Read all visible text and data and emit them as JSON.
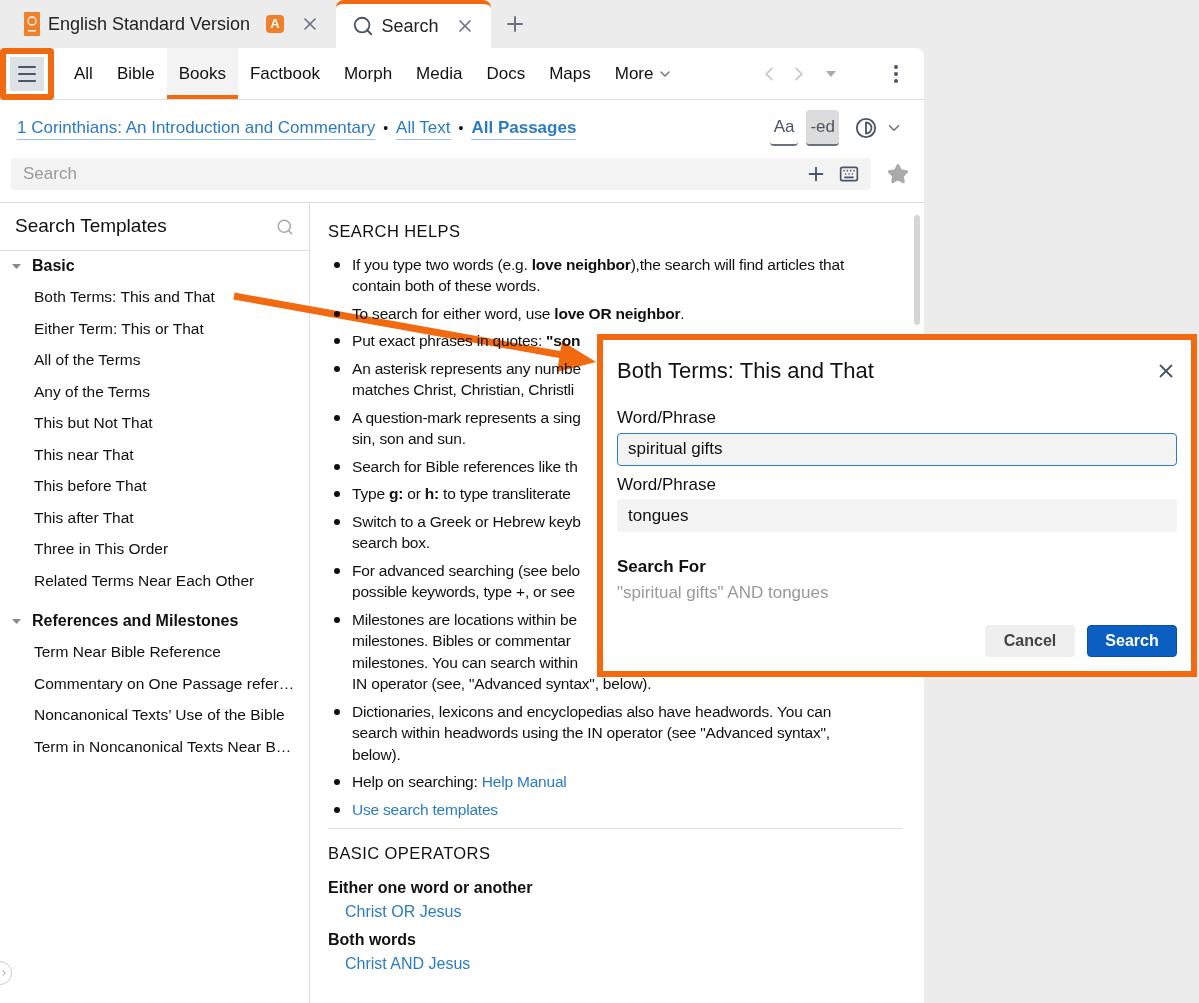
{
  "tabs": [
    {
      "label": "English Standard Version",
      "kind": "book",
      "badge": "A",
      "selected": false
    },
    {
      "label": "Search",
      "kind": "search",
      "selected": true
    }
  ],
  "nav": [
    {
      "label": "All",
      "selected": false
    },
    {
      "label": "Bible",
      "selected": false
    },
    {
      "label": "Books",
      "selected": true
    },
    {
      "label": "Factbook",
      "selected": false
    },
    {
      "label": "Morph",
      "selected": false
    },
    {
      "label": "Media",
      "selected": false
    },
    {
      "label": "Docs",
      "selected": false
    },
    {
      "label": "Maps",
      "selected": false
    },
    {
      "label": "More",
      "selected": false,
      "kind": "menu"
    }
  ],
  "scope": [
    {
      "kind": "link",
      "text": "1 Corinthians: An Introduction and Commentary"
    },
    {
      "kind": "separator",
      "text": "•"
    },
    {
      "kind": "link",
      "text": "All Text"
    },
    {
      "kind": "separator",
      "text": "•"
    },
    {
      "kind": "link",
      "text": "All Passages",
      "bold": true
    }
  ],
  "view_buttons": [
    {
      "label": "Aa",
      "selected": false
    },
    {
      "label": "-ed",
      "selected": true
    }
  ],
  "search": {
    "placeholder": "Search"
  },
  "templates": {
    "title": "Search Templates",
    "groups": [
      {
        "label": "Basic",
        "expanded": true,
        "children": [
          {
            "label": "Both Terms: This and That"
          },
          {
            "label": "Either Term: This or That"
          },
          {
            "label": "All of the Terms"
          },
          {
            "label": "Any of the Terms"
          },
          {
            "label": "This but Not That"
          },
          {
            "label": "This near That"
          },
          {
            "label": "This before That"
          },
          {
            "label": "This after That"
          },
          {
            "label": "Three in This Order"
          },
          {
            "label": "Related Terms Near Each Other"
          }
        ]
      },
      {
        "label": "References and Milestones",
        "expanded": true,
        "children": [
          {
            "label": "Term Near Bible Reference"
          },
          {
            "label": "Commentary on One Passage refer…"
          },
          {
            "label": "Noncanonical Texts’ Use of the Bible"
          },
          {
            "label": "Term in Noncanonical Texts Near B…"
          }
        ]
      }
    ]
  },
  "helps": {
    "title": "SEARCH HELPS",
    "items": [
      {
        "lines": [
          "If you type two words (e.g. **love neighbor**),the search will find articles that",
          "contain both of these words."
        ]
      },
      {
        "lines": [
          "To search for either word, use **love OR neighbor**."
        ]
      },
      {
        "lines": [
          "Put exact phrases in quotes: **\"son**"
        ]
      },
      {
        "lines": [
          "An asterisk represents any numbe",
          "matches Christ, Christian, Christli"
        ]
      },
      {
        "lines": [
          "A question-mark represents a sing",
          "sin, son and sun."
        ]
      },
      {
        "lines": [
          "Search for Bible references like th"
        ]
      },
      {
        "lines": [
          "Type **g:** or **h:** to type transliterate"
        ]
      },
      {
        "lines": [
          "Switch to a Greek or Hebrew keyb",
          "search box."
        ]
      },
      {
        "lines": [
          "For advanced searching (see belo",
          "possible keywords, type +, or see"
        ]
      },
      {
        "lines": [
          "Milestones are locations within be",
          "milestones. Bibles or commentar",
          "milestones. You can search within",
          "IN operator (see, \"Advanced syntax\", below)."
        ]
      },
      {
        "lines": [
          "Dictionaries, lexicons and encyclopedias also have headwords. You can",
          "search within headwords using the IN operator (see \"Advanced syntax\",",
          "below)."
        ]
      },
      {
        "lines": [
          "Help on searching: "
        ],
        "link": "Help Manual"
      },
      {
        "link": "Use search templates"
      }
    ]
  },
  "operators": {
    "title": "BASIC OPERATORS",
    "entries": [
      {
        "label": "Either one word or another",
        "example": "Christ OR Jesus"
      },
      {
        "label": "Both words",
        "example": "Christ AND Jesus"
      }
    ]
  },
  "dialog": {
    "title": "Both Terms: This and That",
    "fields": [
      {
        "label": "Word/Phrase",
        "value": "spiritual gifts",
        "focused": true
      },
      {
        "label": "Word/Phrase",
        "value": "tongues",
        "focused": false
      }
    ],
    "result_label": "Search For",
    "result": "\"spiritual gifts\" AND tongues",
    "buttons": [
      {
        "label": "Cancel",
        "kind": "secondary"
      },
      {
        "label": "Search",
        "kind": "primary"
      }
    ]
  }
}
